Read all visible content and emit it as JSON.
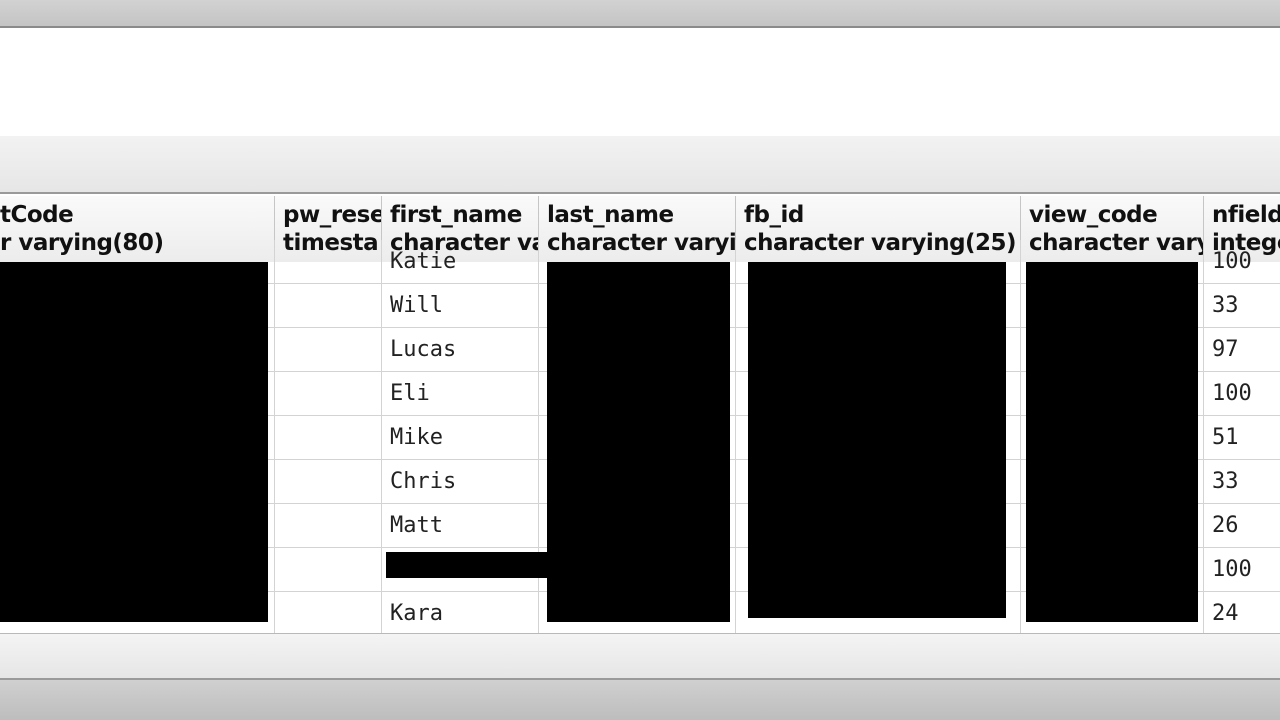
{
  "columns": [
    {
      "name": "tCode",
      "type": "r varying(80)"
    },
    {
      "name": "pw_rese",
      "type": "timesta"
    },
    {
      "name": "first_name",
      "type": "character va"
    },
    {
      "name": "last_name",
      "type": "character varyi"
    },
    {
      "name": "fb_id",
      "type": "character varying(25)"
    },
    {
      "name": "view_code",
      "type": "character vary"
    },
    {
      "name": "nfield",
      "type": "intege"
    }
  ],
  "rows": [
    {
      "first_name": "Katie",
      "nfield": "100"
    },
    {
      "first_name": "Will",
      "nfield": "33"
    },
    {
      "first_name": "Lucas",
      "nfield": "97"
    },
    {
      "first_name": "Eli",
      "nfield": "100"
    },
    {
      "first_name": "Mike",
      "nfield": "51"
    },
    {
      "first_name": "Chris",
      "nfield": "33"
    },
    {
      "first_name": "Matt",
      "nfield": "26"
    },
    {
      "first_name": "",
      "nfield": "100"
    },
    {
      "first_name": "Kara",
      "nfield": "24"
    }
  ],
  "colors": {
    "redaction": "#000000",
    "header_bg": "#f3f3f3",
    "grid_line": "#d3d3d3"
  }
}
